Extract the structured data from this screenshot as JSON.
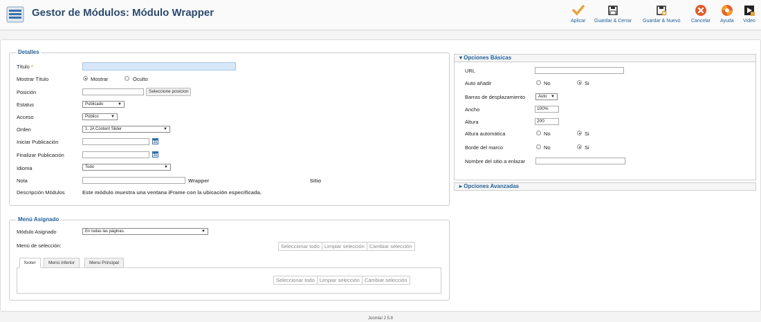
{
  "header": {
    "title": "Gestor de Módulos: Módulo Wrapper",
    "toolbar": [
      {
        "label": "Aplicar",
        "icon": "checkmark-icon",
        "color": "#e8a33c"
      },
      {
        "label": "Guardar & Cerrar",
        "icon": "floppy-icon"
      },
      {
        "label": "Guardar & Nuevo",
        "icon": "floppy-plus-icon"
      },
      {
        "label": "Cancelar",
        "icon": "cancel-icon",
        "color": "#e05a2a"
      },
      {
        "label": "Ayuda",
        "icon": "lifebuoy-icon",
        "color": "#e8602c"
      },
      {
        "label": "Video",
        "icon": "video-icon"
      }
    ]
  },
  "details": {
    "legend": "Detalles",
    "titulo_label": "Título",
    "required_mark": "*",
    "mostrar_titulo_label": "Mostrar Título",
    "mostrar_option": "Mostrar",
    "oculto_option": "Oculto",
    "posicion_label": "Posición",
    "posicion_button": "Seleccione posicion",
    "estatus_label": "Estatus",
    "estatus_value": "Publicado",
    "acceso_label": "Acceso",
    "acceso_value": "Público",
    "orden_label": "Orden",
    "orden_value": "1. JA Content Slider",
    "iniciar_label": "Iniciar Publicación",
    "finalizar_label": "Finalizar Publicación",
    "calendar_text": "31",
    "idioma_label": "Idioma",
    "idioma_value": "Todo",
    "nota_label": "Nota",
    "wrapper_text": "Wrapper",
    "sitio_text": "Sitio",
    "descripcion_label": "Descripción Módulos",
    "descripcion_text": "Este módulo muestra una ventana iFrame con la ubicación especificada."
  },
  "menu": {
    "legend": "Menú Asignado",
    "modulo_asignado_label": "Módulo Asignado",
    "modulo_asignado_value": "En todas las páginas.",
    "menu_seleccion_label": "Menú de selección:",
    "buttons": [
      "Seleccionar todo",
      "Limpiar selección",
      "Cambiar selección"
    ],
    "tabs": [
      "footer",
      "Menú inferior",
      "Menu Principal"
    ]
  },
  "basic": {
    "header": "Opciones Básicas",
    "url_label": "URL",
    "auto_anadir_label": "Auto añadir",
    "no": "No",
    "si": "Si",
    "barras_label": "Barras de desplazamiento",
    "barras_value": "Auto",
    "ancho_label": "Ancho",
    "ancho_value": "100%",
    "altura_label": "Altura",
    "altura_value": "200",
    "altura_auto_label": "Altura automática",
    "borde_label": "Borde del marco",
    "nombre_label": "Nombre del sitio a enlazar"
  },
  "advanced": {
    "header": "Opciones Avanzadas"
  },
  "footer": {
    "text": "Joomla! 2.5.8"
  }
}
